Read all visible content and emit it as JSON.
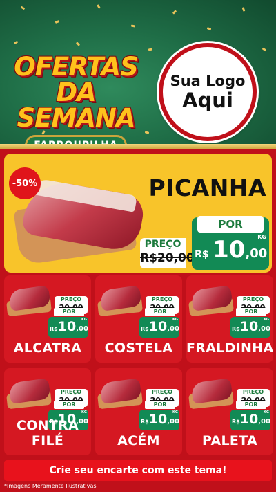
{
  "header": {
    "title_line1": "OFERTAS",
    "title_line2": "DA SEMANA",
    "city": "FARROUPILHA",
    "logo_line1": "Sua Logo",
    "logo_line2": "Aqui"
  },
  "featured": {
    "discount": "-50%",
    "name": "PICANHA",
    "preco_label": "PREÇO",
    "old_price": "R$20,00",
    "por_label": "POR",
    "currency": "R$",
    "price_int": "10",
    "price_dec": ",00",
    "unit": "KG"
  },
  "products": [
    {
      "name": "ALCATRA",
      "preco_label": "PREÇO",
      "old_price": "20,00",
      "por_label": "POR",
      "currency": "R$",
      "price_int": "10",
      "price_dec": ",00",
      "unit": "KG"
    },
    {
      "name": "COSTELA",
      "preco_label": "PREÇO",
      "old_price": "20,00",
      "por_label": "POR",
      "currency": "R$",
      "price_int": "10",
      "price_dec": ",00",
      "unit": "KG"
    },
    {
      "name": "FRALDINHA",
      "preco_label": "PREÇO",
      "old_price": "20,00",
      "por_label": "POR",
      "currency": "R$",
      "price_int": "10",
      "price_dec": ",00",
      "unit": "KG"
    },
    {
      "name": "CONTRA FILÉ",
      "preco_label": "PREÇO",
      "old_price": "20,00",
      "por_label": "POR",
      "currency": "R$",
      "price_int": "10",
      "price_dec": ",00",
      "unit": "KG"
    },
    {
      "name": "ACÉM",
      "preco_label": "PREÇO",
      "old_price": "20,00",
      "por_label": "POR",
      "currency": "R$",
      "price_int": "10",
      "price_dec": ",00",
      "unit": "KG"
    },
    {
      "name": "PALETA",
      "preco_label": "PREÇO",
      "old_price": "20,00",
      "por_label": "POR",
      "currency": "R$",
      "price_int": "10",
      "price_dec": ",00",
      "unit": "KG"
    }
  ],
  "footer": {
    "cta": "Crie seu encarte com este tema!",
    "disclaimer": "*Imagens Meramente Ilustrativas"
  },
  "colors": {
    "brand_red": "#c0101a",
    "brand_green": "#128a55",
    "brand_yellow": "#f8c42a",
    "gold": "#c9a43c"
  }
}
